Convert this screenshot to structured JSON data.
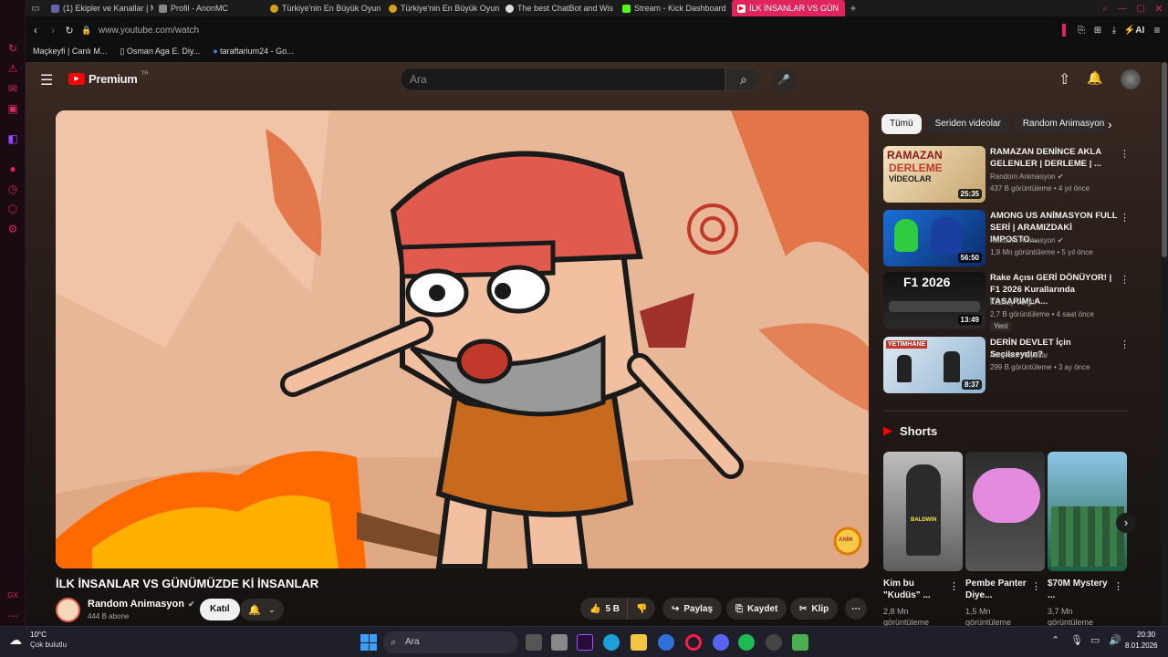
{
  "browser": {
    "tabs": [
      {
        "label": "(1) Ekipler ve Kanallar | Mic",
        "color": "#6264a7"
      },
      {
        "label": "Profil - AnonMC",
        "color": "#888888"
      },
      {
        "label": "Türkiye'nin En Büyük Oyun",
        "color": "#d4a017"
      },
      {
        "label": "Türkiye'nin En Büyük Oyun",
        "color": "#d4a017"
      },
      {
        "label": "The best ChatBot and Wis",
        "color": "#dddddd"
      },
      {
        "label": "Stream - Kick Dashboard",
        "color": "#53fc18"
      },
      {
        "label": "İLK İNSANLAR VS GÜN",
        "color": "#ff0000"
      }
    ],
    "url": "www.youtube.com/watch",
    "ai_label": "AI",
    "bookmarks": [
      "Maçkeyfi | Canlı M...",
      "Osman Aga E. Diy...",
      "taraftarium24 - Go..."
    ]
  },
  "youtube": {
    "logo_text": "Premium",
    "logo_region": "TR",
    "search_placeholder": "Ara",
    "video": {
      "title": "İLK İNSANLAR VS GÜNÜMÜZDE Kİ İNSANLAR",
      "channel": "Random Animasyon",
      "subscribers": "444 B abone",
      "join_label": "Katıl",
      "likes": "5 B",
      "share_label": "Paylaş",
      "save_label": "Kaydet",
      "clip_label": "Klip",
      "watermark": "ANİM"
    },
    "chips": [
      "Tümü",
      "Seriden videolar",
      "Random Animasyon"
    ],
    "recommendations": [
      {
        "title": "RAMAZAN DENİNCE AKLA GELENLER | DERLEME | ...",
        "channel": "Random Animasyon",
        "verified": true,
        "meta": "437 B görüntüleme • 4 yıl önce",
        "duration": "25:35",
        "thumb_text": [
          "RAMAZAN",
          "DERLEME",
          "VİDEOLAR"
        ],
        "badge": ""
      },
      {
        "title": "AMONG US ANİMASYON FULL SERİ | ARAMIZDAKİ IMPOSTO...",
        "channel": "Random Animasyon",
        "verified": true,
        "meta": "1,9 Mn görüntüleme • 5 yıl önce",
        "duration": "56:50",
        "thumb_text": [],
        "badge": ""
      },
      {
        "title": "Rake Açısı GERİ DÖNÜYOR! | F1 2026 Kurallarında TASARIMLA...",
        "channel": "Kubilay Vergili",
        "verified": false,
        "meta": "2,7 B görüntüleme • 4 saat önce",
        "duration": "13:49",
        "thumb_text": [
          "F1 2026"
        ],
        "badge": "Yeni"
      },
      {
        "title": "DERİN DEVLET İçin Seçilseydin?",
        "channel": "Alternatif Hayatlar",
        "verified": false,
        "meta": "299 B görüntüleme • 3 ay önce",
        "duration": "8:37",
        "thumb_text": [
          "YETİMHANE"
        ],
        "badge": ""
      }
    ],
    "shorts_header": "Shorts",
    "shorts": [
      {
        "title": "Kim bu \"Kudüs\" ...",
        "views": "2,8 Mn",
        "meta2": "görüntüleme",
        "thumb_text": "BALDWIN"
      },
      {
        "title": "Pembe Panter Diye...",
        "views": "1,5 Mn",
        "meta2": "görüntüleme",
        "thumb_text": ""
      },
      {
        "title": "$70M Mystery ...",
        "views": "3,7 Mn",
        "meta2": "görüntüleme",
        "thumb_text": ""
      }
    ]
  },
  "taskbar": {
    "weather_temp": "10°C",
    "weather_desc": "Çok bulutlu",
    "search_placeholder": "Ara",
    "time": "20:30",
    "date": "8.01.2026"
  }
}
